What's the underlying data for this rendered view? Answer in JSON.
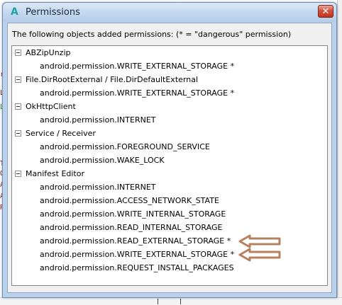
{
  "window": {
    "title": "Permissions",
    "app_icon_glyph": "A",
    "close_glyph": "✕"
  },
  "header": {
    "label": "The following objects added permissions: (* = \"dangerous\" permission)"
  },
  "tree": [
    {
      "label": "ABZipUnzip",
      "permissions": [
        "android.permission.WRITE_EXTERNAL_STORAGE *"
      ]
    },
    {
      "label": "File.DirRootExternal / File.DirDefaultExternal",
      "permissions": [
        "android.permission.WRITE_EXTERNAL_STORAGE *"
      ]
    },
    {
      "label": "OkHttpClient",
      "permissions": [
        "android.permission.INTERNET"
      ]
    },
    {
      "label": "Service / Receiver",
      "permissions": [
        "android.permission.FOREGROUND_SERVICE",
        "android.permission.WAKE_LOCK"
      ]
    },
    {
      "label": "Manifest Editor",
      "permissions": [
        "android.permission.INTERNET",
        "android.permission.ACCESS_NETWORK_STATE",
        "android.permission.WRITE_INTERNAL_STORAGE",
        "android.permission.READ_INTERNAL_STORAGE",
        "android.permission.READ_EXTERNAL_STORAGE *",
        "android.permission.WRITE_EXTERNAL_STORAGE *",
        "android.permission.REQUEST_INSTALL_PACKAGES"
      ]
    }
  ],
  "background": {
    "fragments": [
      "r",
      "Le",
      "Lo",
      "TE",
      "OF",
      "AC",
      "AC",
      "RA"
    ]
  },
  "colors": {
    "title_bar": "#c4d9ef",
    "close_button": "#c2341e",
    "annotation_arrow": "#b5815e",
    "app_icon": "#22a3a3"
  },
  "icons": {
    "app": "app-logo-icon",
    "close": "close-icon",
    "expander": "collapse-minus-icon",
    "annotation": "arrow-left-icon"
  }
}
